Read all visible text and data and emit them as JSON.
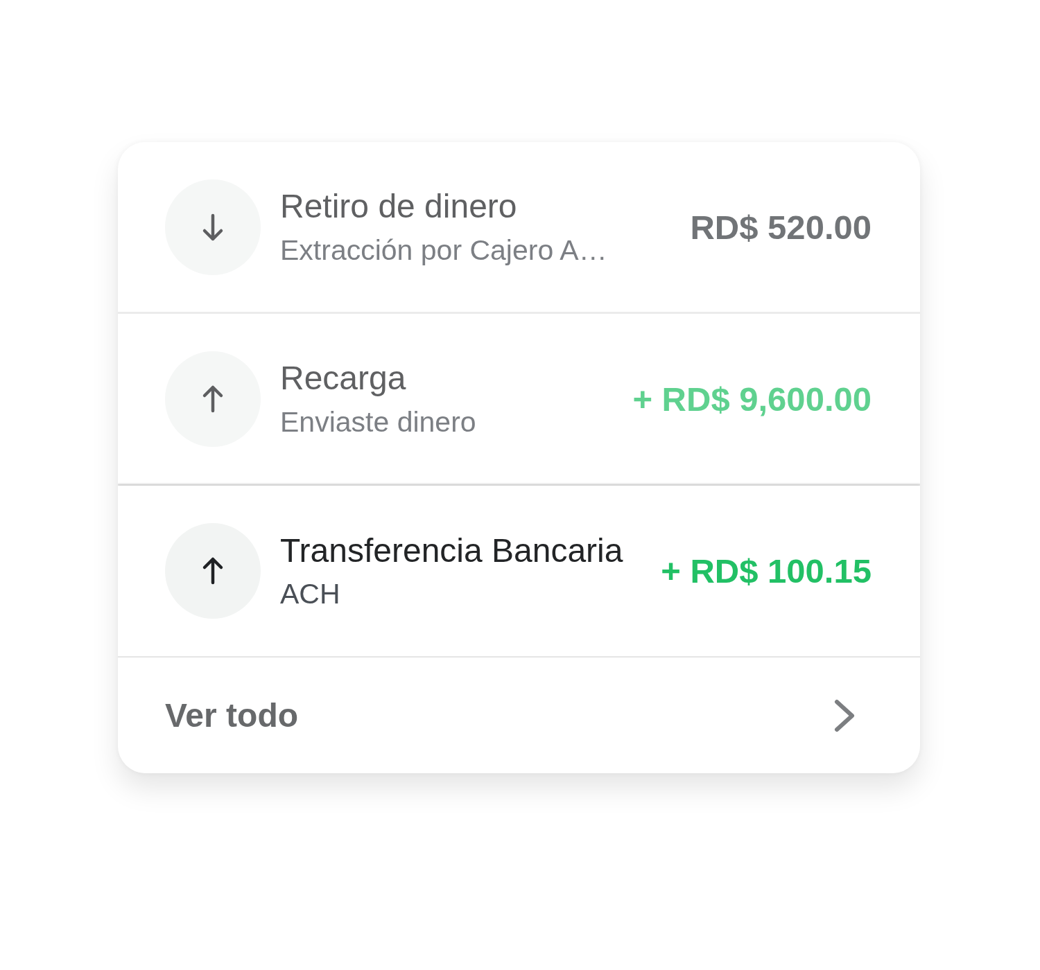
{
  "transactions": [
    {
      "kind": "debit",
      "title": "Retiro de dinero",
      "subtitle": "Extracción por Cajero A…",
      "amount": "RD$ 520.00",
      "focused": false
    },
    {
      "kind": "credit",
      "title": "Recarga",
      "subtitle": "Enviaste dinero",
      "amount": "+ RD$ 9,600.00",
      "focused": false
    },
    {
      "kind": "credit",
      "title": "Transferencia Bancaria",
      "subtitle": "ACH",
      "amount": "+ RD$ 100.15",
      "focused": true
    }
  ],
  "view_all": {
    "label": "Ver todo",
    "focused": false
  }
}
